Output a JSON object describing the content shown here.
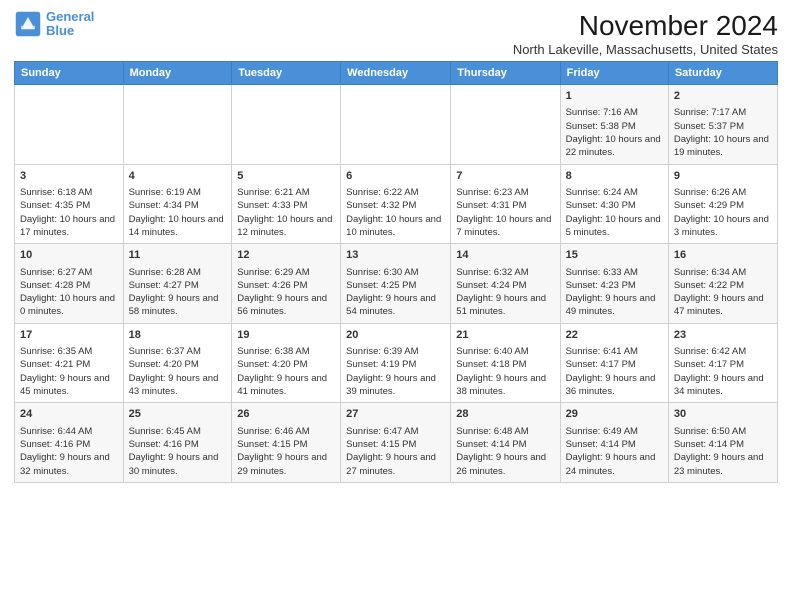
{
  "logo": {
    "line1": "General",
    "line2": "Blue"
  },
  "title": "November 2024",
  "location": "North Lakeville, Massachusetts, United States",
  "days_of_week": [
    "Sunday",
    "Monday",
    "Tuesday",
    "Wednesday",
    "Thursday",
    "Friday",
    "Saturday"
  ],
  "weeks": [
    [
      {
        "day": "",
        "data": ""
      },
      {
        "day": "",
        "data": ""
      },
      {
        "day": "",
        "data": ""
      },
      {
        "day": "",
        "data": ""
      },
      {
        "day": "",
        "data": ""
      },
      {
        "day": "1",
        "data": "Sunrise: 7:16 AM\nSunset: 5:38 PM\nDaylight: 10 hours and 22 minutes."
      },
      {
        "day": "2",
        "data": "Sunrise: 7:17 AM\nSunset: 5:37 PM\nDaylight: 10 hours and 19 minutes."
      }
    ],
    [
      {
        "day": "3",
        "data": "Sunrise: 6:18 AM\nSunset: 4:35 PM\nDaylight: 10 hours and 17 minutes."
      },
      {
        "day": "4",
        "data": "Sunrise: 6:19 AM\nSunset: 4:34 PM\nDaylight: 10 hours and 14 minutes."
      },
      {
        "day": "5",
        "data": "Sunrise: 6:21 AM\nSunset: 4:33 PM\nDaylight: 10 hours and 12 minutes."
      },
      {
        "day": "6",
        "data": "Sunrise: 6:22 AM\nSunset: 4:32 PM\nDaylight: 10 hours and 10 minutes."
      },
      {
        "day": "7",
        "data": "Sunrise: 6:23 AM\nSunset: 4:31 PM\nDaylight: 10 hours and 7 minutes."
      },
      {
        "day": "8",
        "data": "Sunrise: 6:24 AM\nSunset: 4:30 PM\nDaylight: 10 hours and 5 minutes."
      },
      {
        "day": "9",
        "data": "Sunrise: 6:26 AM\nSunset: 4:29 PM\nDaylight: 10 hours and 3 minutes."
      }
    ],
    [
      {
        "day": "10",
        "data": "Sunrise: 6:27 AM\nSunset: 4:28 PM\nDaylight: 10 hours and 0 minutes."
      },
      {
        "day": "11",
        "data": "Sunrise: 6:28 AM\nSunset: 4:27 PM\nDaylight: 9 hours and 58 minutes."
      },
      {
        "day": "12",
        "data": "Sunrise: 6:29 AM\nSunset: 4:26 PM\nDaylight: 9 hours and 56 minutes."
      },
      {
        "day": "13",
        "data": "Sunrise: 6:30 AM\nSunset: 4:25 PM\nDaylight: 9 hours and 54 minutes."
      },
      {
        "day": "14",
        "data": "Sunrise: 6:32 AM\nSunset: 4:24 PM\nDaylight: 9 hours and 51 minutes."
      },
      {
        "day": "15",
        "data": "Sunrise: 6:33 AM\nSunset: 4:23 PM\nDaylight: 9 hours and 49 minutes."
      },
      {
        "day": "16",
        "data": "Sunrise: 6:34 AM\nSunset: 4:22 PM\nDaylight: 9 hours and 47 minutes."
      }
    ],
    [
      {
        "day": "17",
        "data": "Sunrise: 6:35 AM\nSunset: 4:21 PM\nDaylight: 9 hours and 45 minutes."
      },
      {
        "day": "18",
        "data": "Sunrise: 6:37 AM\nSunset: 4:20 PM\nDaylight: 9 hours and 43 minutes."
      },
      {
        "day": "19",
        "data": "Sunrise: 6:38 AM\nSunset: 4:20 PM\nDaylight: 9 hours and 41 minutes."
      },
      {
        "day": "20",
        "data": "Sunrise: 6:39 AM\nSunset: 4:19 PM\nDaylight: 9 hours and 39 minutes."
      },
      {
        "day": "21",
        "data": "Sunrise: 6:40 AM\nSunset: 4:18 PM\nDaylight: 9 hours and 38 minutes."
      },
      {
        "day": "22",
        "data": "Sunrise: 6:41 AM\nSunset: 4:17 PM\nDaylight: 9 hours and 36 minutes."
      },
      {
        "day": "23",
        "data": "Sunrise: 6:42 AM\nSunset: 4:17 PM\nDaylight: 9 hours and 34 minutes."
      }
    ],
    [
      {
        "day": "24",
        "data": "Sunrise: 6:44 AM\nSunset: 4:16 PM\nDaylight: 9 hours and 32 minutes."
      },
      {
        "day": "25",
        "data": "Sunrise: 6:45 AM\nSunset: 4:16 PM\nDaylight: 9 hours and 30 minutes."
      },
      {
        "day": "26",
        "data": "Sunrise: 6:46 AM\nSunset: 4:15 PM\nDaylight: 9 hours and 29 minutes."
      },
      {
        "day": "27",
        "data": "Sunrise: 6:47 AM\nSunset: 4:15 PM\nDaylight: 9 hours and 27 minutes."
      },
      {
        "day": "28",
        "data": "Sunrise: 6:48 AM\nSunset: 4:14 PM\nDaylight: 9 hours and 26 minutes."
      },
      {
        "day": "29",
        "data": "Sunrise: 6:49 AM\nSunset: 4:14 PM\nDaylight: 9 hours and 24 minutes."
      },
      {
        "day": "30",
        "data": "Sunrise: 6:50 AM\nSunset: 4:14 PM\nDaylight: 9 hours and 23 minutes."
      }
    ]
  ]
}
